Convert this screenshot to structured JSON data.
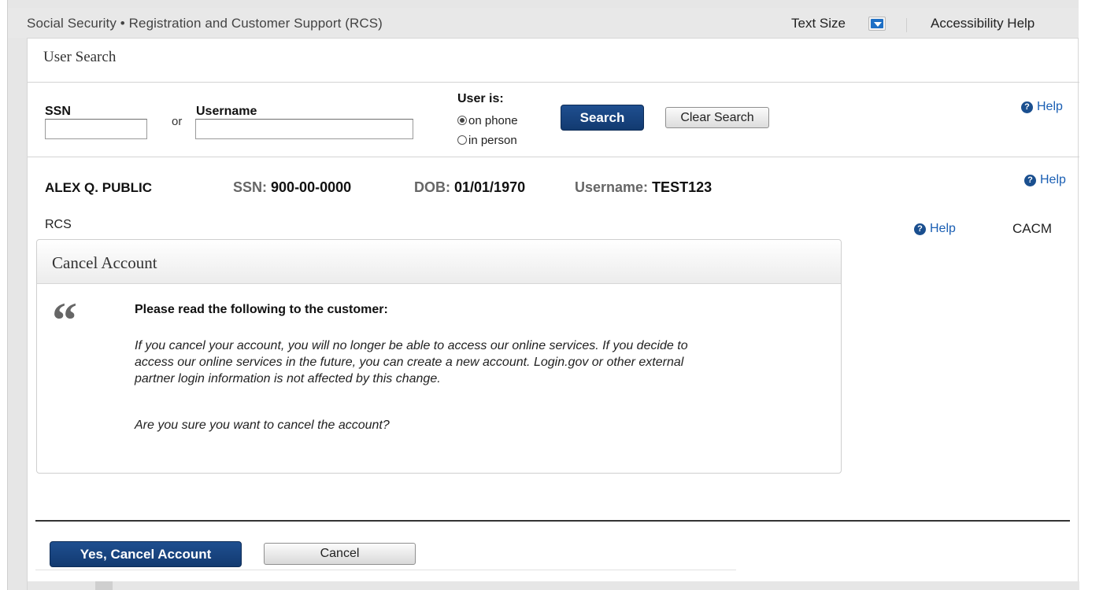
{
  "topbar": {
    "app_title": "Social Security • Registration and Customer Support (RCS)",
    "text_size_label": "Text Size",
    "text_size_icon": "chevron-down-icon",
    "accessibility_help": "Accessibility Help"
  },
  "search": {
    "section_title": "User Search",
    "ssn_label": "SSN",
    "ssn_value": "",
    "or_label": "or",
    "username_label": "Username",
    "username_value": "",
    "user_is_label": "User is:",
    "options": [
      "on phone",
      "in person"
    ],
    "selected_option": "on phone",
    "search_button": "Search",
    "clear_button": "Clear Search",
    "help": "Help"
  },
  "customer": {
    "name": "ALEX Q. PUBLIC",
    "ssn_label": "SSN:",
    "ssn": "900-00-0000",
    "dob_label": "DOB:",
    "dob": "01/01/1970",
    "username_label": "Username:",
    "username": "TEST123",
    "help": "Help"
  },
  "breadcrumb": {
    "left": "RCS",
    "help": "Help",
    "right": "CACM"
  },
  "cancel_account": {
    "title": "Cancel Account",
    "quote_icon": "quote-icon",
    "heading": "Please read the following to the customer:",
    "script": "If you cancel your account, you will no longer be able to access our online services. If you decide to access our online services in the future, you can create a new account. Login.gov or other external partner login information is not affected by this change.",
    "question": "Are you sure you want to cancel the account?"
  },
  "actions": {
    "confirm_button": "Yes, Cancel Account",
    "cancel_button": "Cancel"
  },
  "colors": {
    "primary_button": "#1a4a8a",
    "link": "#1a5fb4",
    "topbar_bg": "#e8e8e8"
  }
}
